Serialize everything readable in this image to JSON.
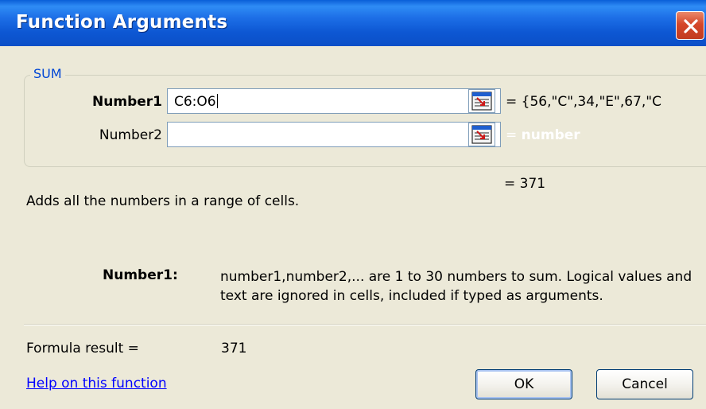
{
  "window": {
    "title": "Function Arguments"
  },
  "function": {
    "name": "SUM"
  },
  "arguments": [
    {
      "label": "Number1",
      "value": "C6:O6",
      "result": "= {56,\"C\",34,\"E\",67,\"C"
    },
    {
      "label": "Number2",
      "value": "",
      "result_prefix": "=",
      "result_hint": "number"
    }
  ],
  "function_result": "= 371",
  "description": "Adds all the numbers in a range of cells.",
  "argument_help": {
    "name": "Number1:",
    "text": "number1,number2,... are 1 to 30 numbers to sum. Logical values and text are ignored in cells, included if typed as arguments."
  },
  "formula_result": {
    "label": "Formula result =",
    "value": "371"
  },
  "help_link": "Help on this function",
  "buttons": {
    "ok": "OK",
    "cancel": "Cancel"
  },
  "colors": {
    "titlebar": "#0b4fc7",
    "group_label": "#0046d5",
    "link": "#0000ff",
    "background": "#ece9d8"
  },
  "icons": {
    "close": "close-icon",
    "ref": "collapse-dialog-icon"
  }
}
